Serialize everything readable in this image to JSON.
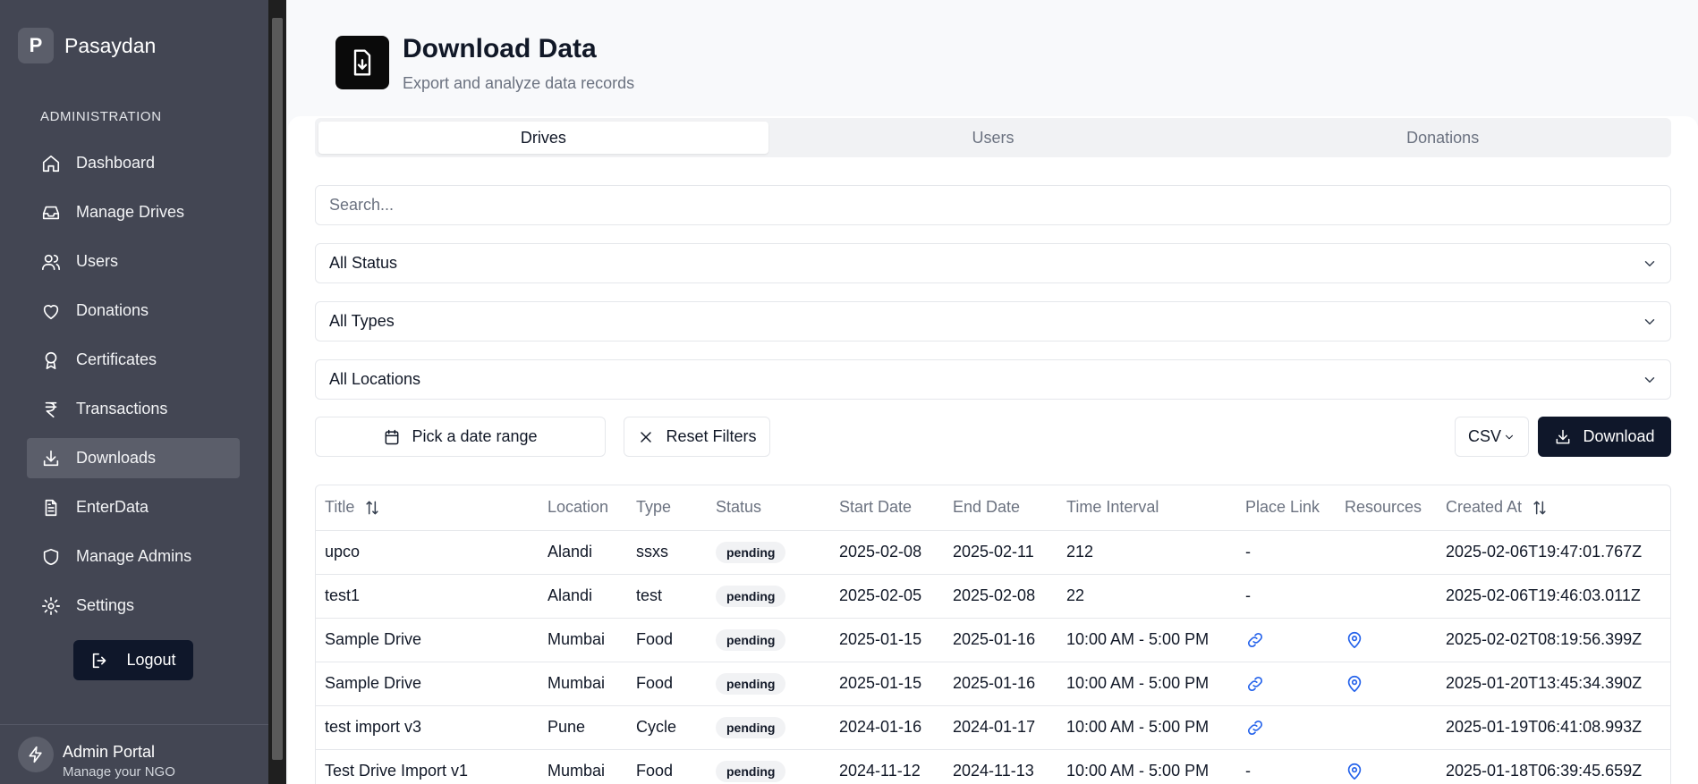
{
  "brand": {
    "logo_letter": "P",
    "name": "Pasaydan"
  },
  "sidebar": {
    "section_label": "ADMINISTRATION",
    "items": [
      {
        "label": "Dashboard",
        "icon": "home-icon",
        "active": false
      },
      {
        "label": "Manage Drives",
        "icon": "inbox-icon",
        "active": false
      },
      {
        "label": "Users",
        "icon": "users-icon",
        "active": false
      },
      {
        "label": "Donations",
        "icon": "heart-icon",
        "active": false
      },
      {
        "label": "Certificates",
        "icon": "award-icon",
        "active": false
      },
      {
        "label": "Transactions",
        "icon": "rupee-icon",
        "active": false
      },
      {
        "label": "Downloads",
        "icon": "download-icon",
        "active": true
      },
      {
        "label": "EnterData",
        "icon": "file-text-icon",
        "active": false
      },
      {
        "label": "Manage Admins",
        "icon": "shield-icon",
        "active": false
      },
      {
        "label": "Settings",
        "icon": "gear-icon",
        "active": false
      }
    ],
    "logout_label": "Logout",
    "footer": {
      "title": "Admin Portal",
      "subtitle": "Manage your NGO"
    }
  },
  "header": {
    "title": "Download Data",
    "subtitle": "Export and analyze data records"
  },
  "tabs": [
    {
      "label": "Drives",
      "active": true
    },
    {
      "label": "Users",
      "active": false
    },
    {
      "label": "Donations",
      "active": false
    }
  ],
  "filters": {
    "search_placeholder": "Search...",
    "status": "All Status",
    "types": "All Types",
    "locations": "All Locations",
    "date_range_label": "Pick a date range",
    "reset_label": "Reset Filters",
    "format": "CSV",
    "download_label": "Download"
  },
  "table": {
    "columns": [
      "Title",
      "Location",
      "Type",
      "Status",
      "Start Date",
      "End Date",
      "Time Interval",
      "Place Link",
      "Resources",
      "Created At"
    ],
    "rows": [
      {
        "title": "upco",
        "location": "Alandi",
        "type": "ssxs",
        "status": "pending",
        "start": "2025-02-08",
        "end": "2025-02-11",
        "interval": "212",
        "place_link": "-",
        "resources": "",
        "created": "2025-02-06T19:47:01.767Z"
      },
      {
        "title": "test1",
        "location": "Alandi",
        "type": "test",
        "status": "pending",
        "start": "2025-02-05",
        "end": "2025-02-08",
        "interval": "22",
        "place_link": "-",
        "resources": "",
        "created": "2025-02-06T19:46:03.011Z"
      },
      {
        "title": "Sample Drive",
        "location": "Mumbai",
        "type": "Food",
        "status": "pending",
        "start": "2025-01-15",
        "end": "2025-01-16",
        "interval": "10:00 AM - 5:00 PM",
        "place_link": "link-icon",
        "resources": "map-pin-icon",
        "created": "2025-02-02T08:19:56.399Z"
      },
      {
        "title": "Sample Drive",
        "location": "Mumbai",
        "type": "Food",
        "status": "pending",
        "start": "2025-01-15",
        "end": "2025-01-16",
        "interval": "10:00 AM - 5:00 PM",
        "place_link": "link-icon",
        "resources": "map-pin-icon",
        "created": "2025-01-20T13:45:34.390Z"
      },
      {
        "title": "test import v3",
        "location": "Pune",
        "type": "Cycle",
        "status": "pending",
        "start": "2024-01-16",
        "end": "2024-01-17",
        "interval": "10:00 AM - 5:00 PM",
        "place_link": "link-icon",
        "resources": "",
        "created": "2025-01-19T06:41:08.993Z"
      },
      {
        "title": "Test Drive Import v1",
        "location": "Mumbai",
        "type": "Food",
        "status": "pending",
        "start": "2024-11-12",
        "end": "2024-11-13",
        "interval": "10:00 AM - 5:00 PM",
        "place_link": "-",
        "resources": "map-pin-icon",
        "created": "2025-01-18T06:39:45.659Z"
      }
    ]
  },
  "colors": {
    "sidebar_bg": "#434653",
    "active_item": "#5b5e6a",
    "primary_dark": "#0f172a",
    "link_blue": "#2563eb"
  }
}
